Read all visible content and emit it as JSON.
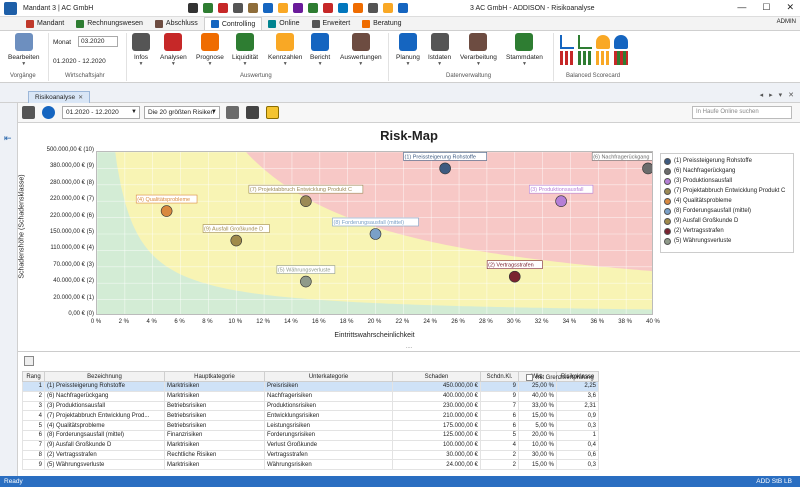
{
  "titlebar": {
    "left": "Mandant 3 | AC GmbH",
    "center": "3 AC GmbH - ADDISON - Risikoanalyse",
    "user": "ADMIN"
  },
  "ribbon_tabs": [
    {
      "label": "Mandant",
      "active": false,
      "color": "#c0392b"
    },
    {
      "label": "Rechnungswesen",
      "active": false,
      "color": "#2e7d32"
    },
    {
      "label": "Abschluss",
      "active": false,
      "color": "#6d4c41"
    },
    {
      "label": "Controlling",
      "active": true,
      "color": "#1565c0"
    },
    {
      "label": "Online",
      "active": false,
      "color": "#00838f"
    },
    {
      "label": "Erweitert",
      "active": false,
      "color": "#555555"
    },
    {
      "label": "Beratung",
      "active": false,
      "color": "#ef6c00"
    }
  ],
  "ribbon": {
    "bearbeiten": "Bearbeiten",
    "vorgaenge": "Vorgänge",
    "monat_label": "Monat",
    "monat_value": "03.2020",
    "range": "01.2020 - 12.2020",
    "wirtschaftsjahr": "Wirtschaftsjahr",
    "auswertung_buttons": [
      "Infos",
      "Analysen",
      "Prognose",
      "Liquidität",
      "Kennzahlen",
      "Bericht",
      "Auswertungen"
    ],
    "auswertung_label": "Auswertung",
    "daten_buttons": [
      "Planung",
      "Istdaten",
      "Verarbeitung",
      "Stammdaten"
    ],
    "daten_label": "Datenverwaltung",
    "bsc_label": "Balanced Scorecard"
  },
  "doc": {
    "tab": "Risikoanalyse"
  },
  "toolbar": {
    "period": "01.2020 - 12.2020",
    "filter": "Die 20 größten Risiken",
    "search_placeholder": "In Haufe Online suchen"
  },
  "chart_data": {
    "type": "scatter",
    "title": "Risk-Map",
    "xlabel": "Eintrittswahrscheinlichkeit",
    "ylabel": "Schadenshöhe (Schadensklasse)",
    "xlim": [
      0,
      40
    ],
    "ylim": [
      0,
      500000
    ],
    "x_ticks": [
      "0 %",
      "2 %",
      "4 %",
      "6 %",
      "8 %",
      "10 %",
      "12 %",
      "14 %",
      "16 %",
      "18 %",
      "20 %",
      "22 %",
      "24 %",
      "26 %",
      "28 %",
      "30 %",
      "32 %",
      "34 %",
      "36 %",
      "38 %",
      "40 %"
    ],
    "y_ticks": [
      "0,00 € (0)",
      "20.000,00 € (1)",
      "40.000,00 € (2)",
      "70.000,00 € (3)",
      "110.000,00 € (4)",
      "150.000,00 € (5)",
      "220.000,00 € (6)",
      "220.000,00 € (7)",
      "280.000,00 € (8)",
      "380.000,00 € (9)",
      "500.000,00 € (10)"
    ],
    "points": [
      {
        "label": "(1) Preissteigerung Rohstoffe",
        "x": 25,
        "y_class": 9,
        "color": "#3d5a80"
      },
      {
        "label": "(6) Nachfragerückgang",
        "x": 40,
        "y_class": 9,
        "color": "#6b6b6b"
      },
      {
        "label": "(3) Produktionsausfall",
        "x": 33.33,
        "y_class": 7,
        "color": "#b57fd6"
      },
      {
        "label": "(7) Projektabbruch Entwicklung Produkt C",
        "x": 15,
        "y_class": 7,
        "color": "#9c8a55"
      },
      {
        "label": "(4) Qualitätsprobleme",
        "x": 5,
        "y_class": 6.4,
        "color": "#d9893f"
      },
      {
        "label": "(8) Forderungsausfall (mittel)",
        "x": 20,
        "y_class": 5,
        "color": "#7aa0c8"
      },
      {
        "label": "(9) Ausfall Großkunde D",
        "x": 10,
        "y_class": 4.6,
        "color": "#a08a4a"
      },
      {
        "label": "(2) Vertragsstrafen",
        "x": 30,
        "y_class": 2.4,
        "color": "#7a2230"
      },
      {
        "label": "(5) Währungsverluste",
        "x": 15,
        "y_class": 2.1,
        "color": "#8f9a8a"
      }
    ]
  },
  "legend": [
    {
      "label": "(1) Preissteigerung Rohstoffe",
      "color": "#3d5a80"
    },
    {
      "label": "(6) Nachfragerückgang",
      "color": "#6b6b6b"
    },
    {
      "label": "(3) Produktionsausfall",
      "color": "#b57fd6"
    },
    {
      "label": "(7) Projektabbruch Entwicklung Produkt C",
      "color": "#9c8a55"
    },
    {
      "label": "(4) Qualitätsprobleme",
      "color": "#d9893f"
    },
    {
      "label": "(8) Forderungsausfall (mittel)",
      "color": "#7aa0c8"
    },
    {
      "label": "(9) Ausfall Großkunde D",
      "color": "#a08a4a"
    },
    {
      "label": "(2) Vertragsstrafen",
      "color": "#7a2230"
    },
    {
      "label": "(5) Währungsverluste",
      "color": "#8f9a8a"
    }
  ],
  "table": {
    "headers": [
      "Rang",
      "Bezeichnung",
      "Hauptkategorie",
      "Unterkategorie",
      "Schaden",
      "Schdn.Kl.",
      "Wkt.",
      "Risikoklasse"
    ],
    "rows": [
      [
        "1",
        "(1) Preissteigerung Rohstoffe",
        "Marktrisiken",
        "Preisrisiken",
        "450.000,00 €",
        "9",
        "25,00 %",
        "2,25"
      ],
      [
        "2",
        "(6) Nachfragerückgang",
        "Marktrisiken",
        "Nachfragerisiken",
        "400.000,00 €",
        "9",
        "40,00 %",
        "3,6"
      ],
      [
        "3",
        "(3) Produktionsausfall",
        "Betriebsrisiken",
        "Produktionsrisiken",
        "230.000,00 €",
        "7",
        "33,00 %",
        "2,31"
      ],
      [
        "4",
        "(7) Projektabbruch Entwicklung Prod...",
        "Betriebsrisiken",
        "Entwicklungsrisiken",
        "210.000,00 €",
        "6",
        "15,00 %",
        "0,9"
      ],
      [
        "5",
        "(4) Qualitätsprobleme",
        "Betriebsrisiken",
        "Leistungsrisiken",
        "175.000,00 €",
        "6",
        "5,00 %",
        "0,3"
      ],
      [
        "6",
        "(8) Forderungsausfall (mittel)",
        "Finanzrisiken",
        "Forderungsrisiken",
        "125.000,00 €",
        "5",
        "20,00 %",
        "1"
      ],
      [
        "7",
        "(9) Ausfall Großkunde D",
        "Marktrisiken",
        "Verlust Großkunde",
        "100.000,00 €",
        "4",
        "10,00 %",
        "0,4"
      ],
      [
        "8",
        "(2) Vertragsstrafen",
        "Rechtliche Risiken",
        "Vertragsstrafen",
        "30.000,00 €",
        "2",
        "30,00 %",
        "0,6"
      ],
      [
        "9",
        "(5) Währungsverluste",
        "Marktrisiken",
        "Währungsrisiken",
        "24.000,00 €",
        "2",
        "15,00 %",
        "0,3"
      ]
    ],
    "grenzwert_label": "mit Grenzwertprüfung"
  },
  "status": {
    "left": "Ready",
    "right": "ADD StB LB"
  }
}
